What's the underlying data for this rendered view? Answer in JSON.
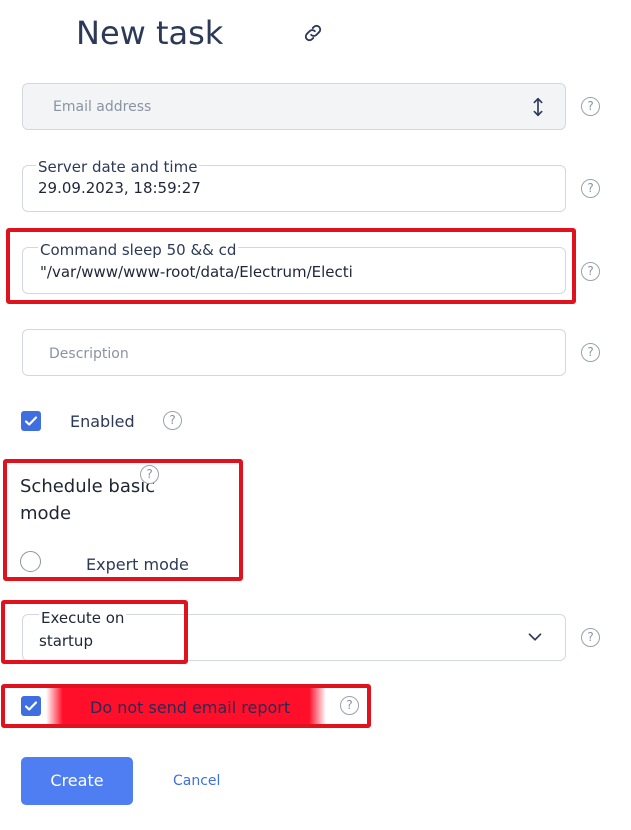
{
  "page": {
    "title": "New task"
  },
  "form": {
    "email": {
      "placeholder": "Email address"
    },
    "server_datetime": {
      "label": "Server date and time",
      "value": "29.09.2023, 18:59:27"
    },
    "command": {
      "label": "Command sleep 50 && cd",
      "value": "\"/var/www/www-root/data/Electrum/Electi"
    },
    "description": {
      "placeholder": "Description"
    },
    "enabled": {
      "label": "Enabled",
      "checked": true
    },
    "schedule": {
      "label_line1": "Schedule basic",
      "label_line2": "mode",
      "expert_label": "Expert mode"
    },
    "execute": {
      "label_line1": "Execute on",
      "label_line2": "startup"
    },
    "email_report": {
      "label": "Do not send email report",
      "checked": true
    }
  },
  "help_glyph": "?",
  "buttons": {
    "create": "Create",
    "cancel": "Cancel"
  },
  "colors": {
    "accent": "#4f7ef2",
    "highlight_red": "#e0121e",
    "title": "#2c3a57"
  },
  "icons": [
    "link-icon",
    "sort-arrows-icon",
    "help-icon",
    "chevron-down-icon",
    "check-icon"
  ]
}
